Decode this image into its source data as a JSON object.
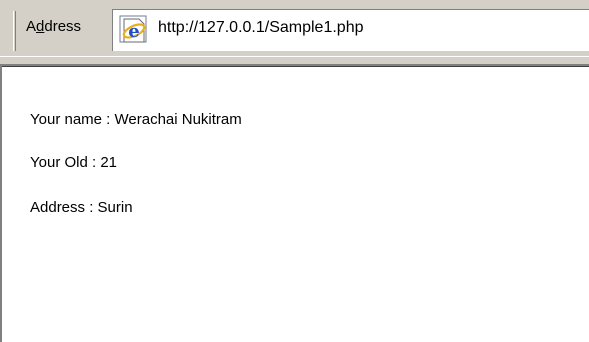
{
  "toolbar": {
    "address_label_first": "A",
    "address_label_underlined": "d",
    "address_label_rest": "dress",
    "url": "http://127.0.0.1/Sample1.php",
    "page_icon": "internet-explorer-icon"
  },
  "page": {
    "lines": [
      "Your name : Werachai Nukitram",
      "Your Old : 21",
      "Address : Surin"
    ]
  },
  "colors": {
    "toolbar_bg": "#d4d0c8",
    "page_bg": "#ffffff",
    "text": "#000000",
    "ie_blue": "#1e4fc9",
    "ie_gold": "#e8b020"
  }
}
